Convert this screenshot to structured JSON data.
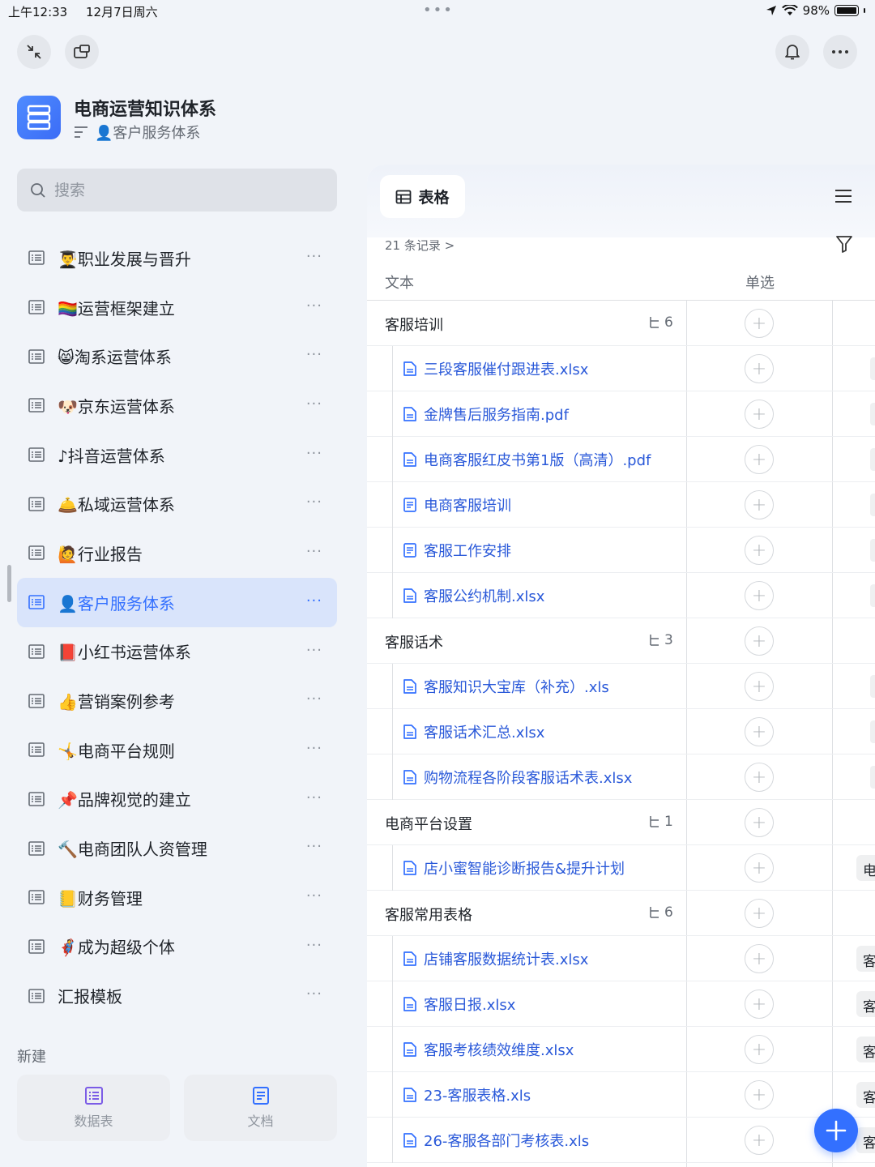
{
  "status": {
    "time": "上午12:33",
    "date": "12月7日周六",
    "battery": "98%"
  },
  "workspace": {
    "title": "电商运营知识体系",
    "breadcrumb": "👤客户服务体系"
  },
  "search": {
    "placeholder": "搜索"
  },
  "sidebar": {
    "items": [
      {
        "label": "👨‍🎓职业发展与晋升"
      },
      {
        "label": "🏳️‍🌈运营框架建立"
      },
      {
        "label": "😸淘系运营体系"
      },
      {
        "label": "🐶京东运营体系"
      },
      {
        "label": "♪抖音运营体系"
      },
      {
        "label": "🛎️私域运营体系"
      },
      {
        "label": "🙋行业报告"
      },
      {
        "label": "👤客户服务体系",
        "active": true
      },
      {
        "label": "📕小红书运营体系"
      },
      {
        "label": "👍营销案例参考"
      },
      {
        "label": "🤸电商平台规则"
      },
      {
        "label": "📌品牌视觉的建立"
      },
      {
        "label": "🔨电商团队人资管理"
      },
      {
        "label": "📒财务管理"
      },
      {
        "label": "🦸成为超级个体"
      },
      {
        "label": "汇报模板"
      }
    ],
    "more_glyph": "···"
  },
  "create": {
    "label": "新建",
    "datasheet_label": "数据表",
    "doc_label": "文档"
  },
  "table": {
    "tab_label": "表格",
    "records": "21 条记录",
    "records_chevron": ">",
    "col_text": "文本",
    "col_single": "单选",
    "rows": [
      {
        "type": "group",
        "name": "客服培训",
        "count": "6"
      },
      {
        "type": "child",
        "name": "三段客服催付跟进表.xlsx",
        "icon": "file-icon",
        "tag": ""
      },
      {
        "type": "child",
        "name": "金牌售后服务指南.pdf",
        "icon": "file-icon",
        "tag": ""
      },
      {
        "type": "child",
        "name": "电商客服红皮书第1版（高清）.pdf",
        "icon": "file-icon",
        "tag": ""
      },
      {
        "type": "child",
        "name": "电商客服培训",
        "icon": "doc-icon",
        "tag": ""
      },
      {
        "type": "child",
        "name": "客服工作安排",
        "icon": "doc-icon",
        "tag": ""
      },
      {
        "type": "child",
        "name": "客服公约机制.xlsx",
        "icon": "file-icon",
        "tag": ""
      },
      {
        "type": "group",
        "name": "客服话术",
        "count": "3"
      },
      {
        "type": "child",
        "name": "客服知识大宝库（补充）.xls",
        "icon": "file-icon",
        "tag": ""
      },
      {
        "type": "child",
        "name": "客服话术汇总.xlsx",
        "icon": "file-icon",
        "tag": ""
      },
      {
        "type": "child",
        "name": "购物流程各阶段客服话术表.xlsx",
        "icon": "file-icon",
        "tag": ""
      },
      {
        "type": "group",
        "name": "电商平台设置",
        "count": "1"
      },
      {
        "type": "child",
        "name": "店小蜜智能诊断报告&提升计划",
        "icon": "file-icon",
        "tag": "电"
      },
      {
        "type": "group",
        "name": "客服常用表格",
        "count": "6"
      },
      {
        "type": "child",
        "name": "店铺客服数据统计表.xlsx",
        "icon": "file-icon",
        "tag": "客"
      },
      {
        "type": "child",
        "name": "客服日报.xlsx",
        "icon": "file-icon",
        "tag": "客"
      },
      {
        "type": "child",
        "name": "客服考核绩效维度.xlsx",
        "icon": "file-icon",
        "tag": "客"
      },
      {
        "type": "child",
        "name": "23-客服表格.xls",
        "icon": "file-icon",
        "tag": "客"
      },
      {
        "type": "child",
        "name": "26-客服各部门考核表.xls",
        "icon": "file-icon",
        "tag": "客"
      }
    ]
  },
  "colors": {
    "accent": "#3370ff",
    "link": "#2a59d9",
    "active_bg": "#d9e4fb"
  }
}
